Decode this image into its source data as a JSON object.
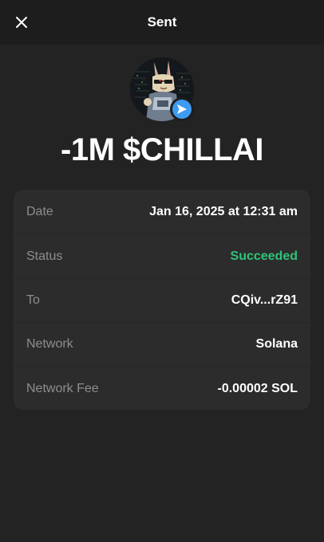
{
  "header": {
    "title": "Sent",
    "close_icon": "close-icon"
  },
  "transaction": {
    "amount": "-1M $CHILLAI",
    "avatar_icon": "token-avatar",
    "badge_icon": "send-arrow-icon",
    "badge_color": "#3e9bf2"
  },
  "details": {
    "rows": [
      {
        "label": "Date",
        "value": "Jan 16, 2025 at 12:31 am"
      },
      {
        "label": "Status",
        "value": "Succeeded"
      },
      {
        "label": "To",
        "value": "CQiv...rZ91"
      },
      {
        "label": "Network",
        "value": "Solana"
      },
      {
        "label": "Network Fee",
        "value": "-0.00002 SOL"
      }
    ]
  },
  "colors": {
    "background": "#232323",
    "header_background": "#1d1d1d",
    "card_background": "#2c2c2c",
    "label_text": "#8e8e8e",
    "success": "#2ec47a",
    "accent": "#3e9bf2"
  }
}
